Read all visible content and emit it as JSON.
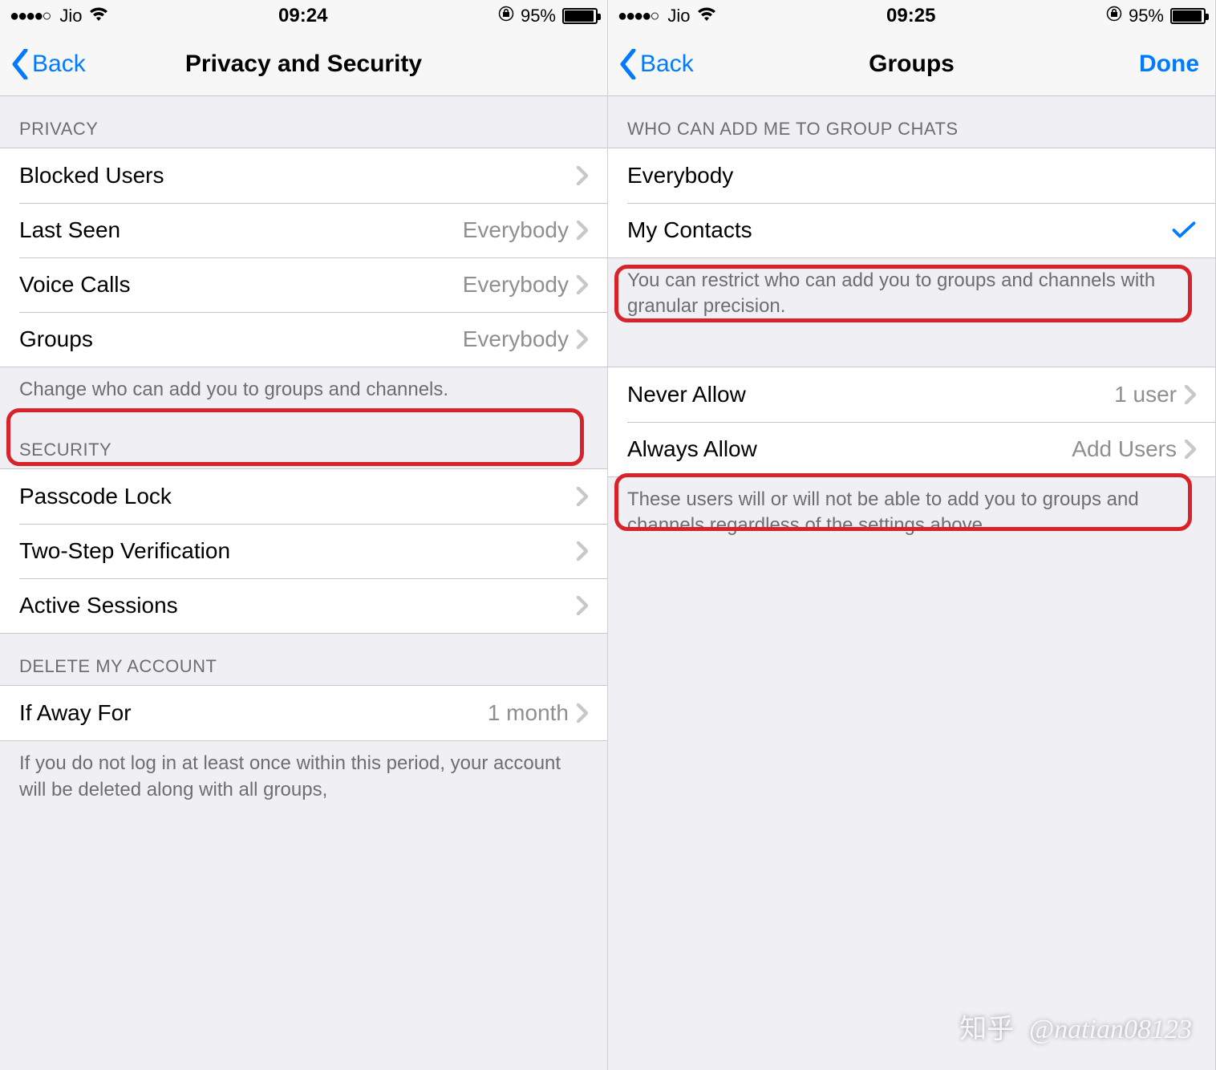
{
  "left": {
    "status": {
      "carrier": "Jio",
      "time": "09:24",
      "battery_pct": "95%"
    },
    "nav": {
      "back": "Back",
      "title": "Privacy and Security"
    },
    "sections": {
      "privacy": {
        "header": "PRIVACY",
        "rows": {
          "blocked": {
            "label": "Blocked Users",
            "value": ""
          },
          "lastseen": {
            "label": "Last Seen",
            "value": "Everybody"
          },
          "voice": {
            "label": "Voice Calls",
            "value": "Everybody"
          },
          "groups": {
            "label": "Groups",
            "value": "Everybody"
          }
        },
        "footer": "Change who can add you to groups and channels."
      },
      "security": {
        "header": "SECURITY",
        "rows": {
          "passcode": {
            "label": "Passcode Lock"
          },
          "twostep": {
            "label": "Two-Step Verification"
          },
          "sessions": {
            "label": "Active Sessions"
          }
        }
      },
      "delete": {
        "header": "DELETE MY ACCOUNT",
        "rows": {
          "ifaway": {
            "label": "If Away For",
            "value": "1 month"
          }
        },
        "footer": "If you do not log in at least once within this period, your account will be deleted along with all groups,"
      }
    }
  },
  "right": {
    "status": {
      "carrier": "Jio",
      "time": "09:25",
      "battery_pct": "95%"
    },
    "nav": {
      "back": "Back",
      "title": "Groups",
      "done": "Done"
    },
    "sections": {
      "who": {
        "header": "WHO CAN ADD ME TO GROUP CHATS",
        "rows": {
          "everybody": {
            "label": "Everybody"
          },
          "mycontacts": {
            "label": "My Contacts"
          }
        },
        "footer": "You can restrict who can add you to groups and channels with granular precision."
      },
      "exceptions": {
        "rows": {
          "never": {
            "label": "Never Allow",
            "value": "1 user"
          },
          "always": {
            "label": "Always Allow",
            "value": "Add Users"
          }
        },
        "footer": "These users will or will not be able to add you to groups and channels regardless of the settings above."
      }
    }
  },
  "watermark": {
    "prefix": "知乎",
    "handle": "@natian08123"
  }
}
